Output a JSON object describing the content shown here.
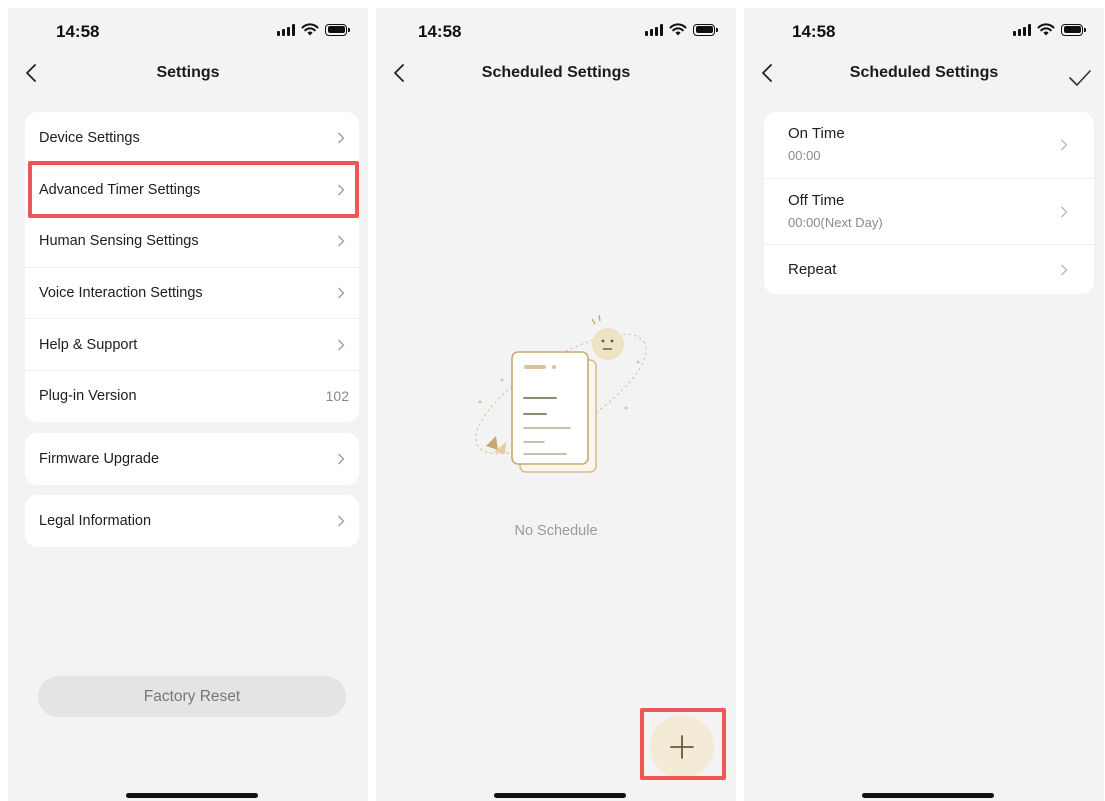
{
  "status_bar": {
    "time": "14:58"
  },
  "settings_screen": {
    "title": "Settings",
    "group1": [
      {
        "label": "Device Settings"
      },
      {
        "label": "Advanced Timer Settings"
      },
      {
        "label": "Human Sensing Settings"
      },
      {
        "label": "Voice Interaction Settings"
      },
      {
        "label": "Help & Support"
      },
      {
        "label": "Plug-in Version",
        "value": "102"
      }
    ],
    "group2": [
      {
        "label": "Firmware Upgrade"
      }
    ],
    "group3": [
      {
        "label": "Legal Information"
      }
    ],
    "factory_reset_label": "Factory Reset"
  },
  "schedule_screen": {
    "title": "Scheduled Settings",
    "empty_text": "No Schedule",
    "add_icon": "plus-icon"
  },
  "schedule_edit_screen": {
    "title": "Scheduled Settings",
    "confirm_icon": "checkmark-icon",
    "rows": [
      {
        "label": "On Time",
        "sub": "00:00"
      },
      {
        "label": "Off Time",
        "sub": "00:00(Next Day)"
      },
      {
        "label": "Repeat"
      }
    ]
  },
  "colors": {
    "highlight": "#ef5658",
    "background": "#f3f3f3",
    "fab": "#f4ebd6",
    "accent_gold": "#c9a970"
  }
}
